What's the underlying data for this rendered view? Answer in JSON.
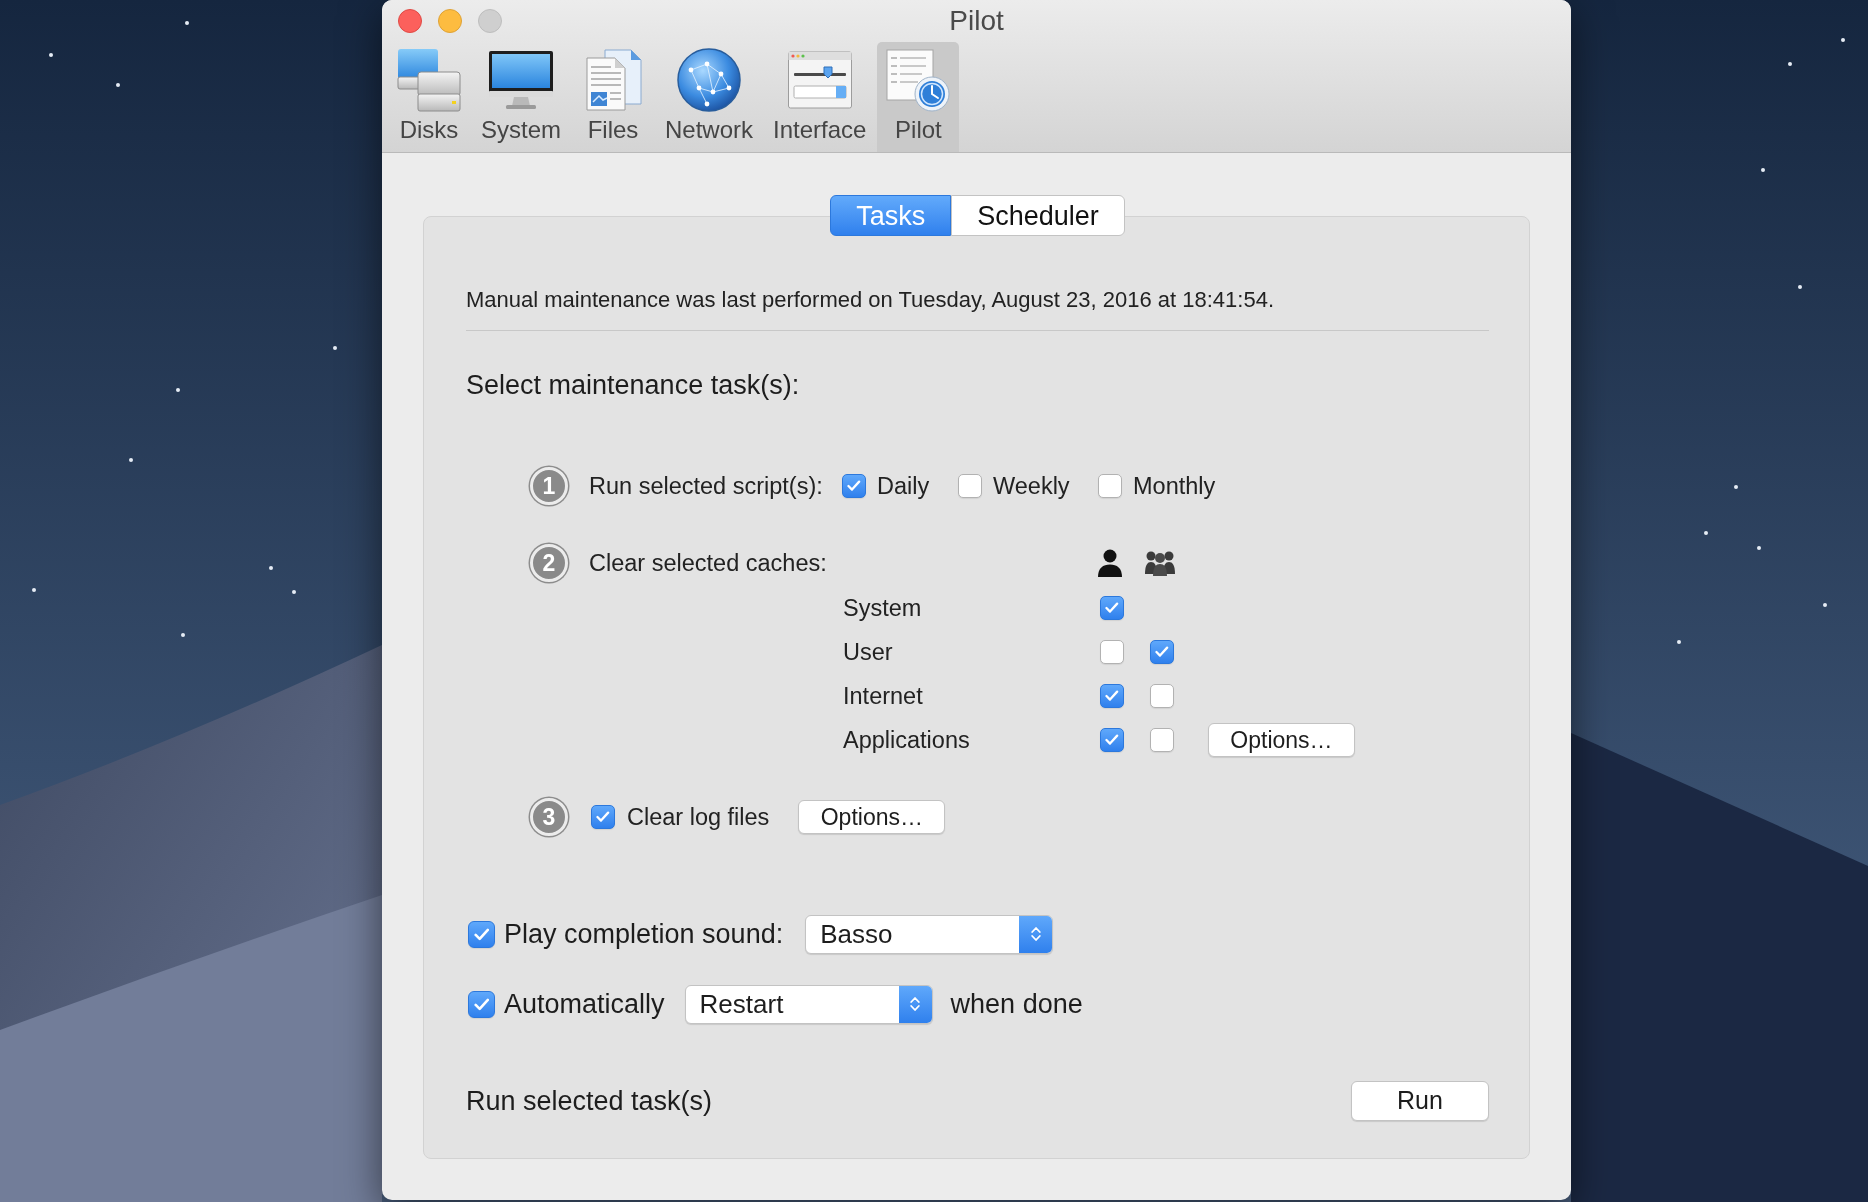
{
  "window": {
    "title": "Pilot"
  },
  "toolbar": [
    {
      "label": "Disks",
      "kind": "disks",
      "selected": false
    },
    {
      "label": "System",
      "kind": "system",
      "selected": false
    },
    {
      "label": "Files",
      "kind": "files",
      "selected": false
    },
    {
      "label": "Network",
      "kind": "network",
      "selected": false
    },
    {
      "label": "Interface",
      "kind": "interface",
      "selected": false
    },
    {
      "label": "Pilot",
      "kind": "pilot",
      "selected": true
    }
  ],
  "tabs": [
    {
      "label": "Tasks",
      "selected": true
    },
    {
      "label": "Scheduler",
      "selected": false
    }
  ],
  "status": "Manual maintenance was last performed on Tuesday, August 23, 2016 at 18:41:54.",
  "heading": "Select maintenance task(s):",
  "steps": [
    {
      "kind": "scripts",
      "number": "1",
      "label": "Run selected script(s):",
      "options": [
        {
          "label": "Daily",
          "checked": true
        },
        {
          "label": "Weekly",
          "checked": false
        },
        {
          "label": "Monthly",
          "checked": false
        }
      ]
    },
    {
      "kind": "caches",
      "number": "2",
      "label": "Clear selected caches:",
      "rows": [
        {
          "label": "System",
          "checks": [
            {
              "checked": true
            }
          ]
        },
        {
          "label": "User",
          "checks": [
            {
              "checked": false
            },
            {
              "checked": true
            }
          ]
        },
        {
          "label": "Internet",
          "checks": [
            {
              "checked": true
            },
            {
              "checked": false
            }
          ]
        },
        {
          "label": "Applications",
          "checks": [
            {
              "checked": true
            },
            {
              "checked": false
            }
          ],
          "button": "Options…"
        }
      ]
    },
    {
      "kind": "logs",
      "number": "3",
      "label": "Clear log files",
      "checked": true,
      "button": "Options…"
    }
  ],
  "sound": {
    "label": "Play completion sound:",
    "checked": true,
    "value": "Basso"
  },
  "auto_action": {
    "label": "Automatically",
    "checked": true,
    "value": "Restart",
    "suffix": "when done"
  },
  "footer": {
    "label": "Run selected task(s)",
    "button": "Run"
  }
}
